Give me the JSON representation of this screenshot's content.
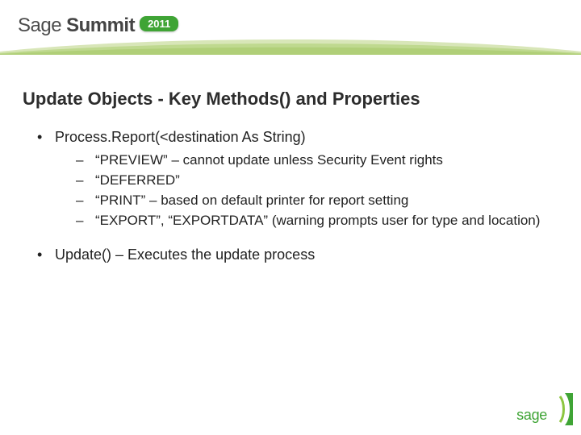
{
  "brand": {
    "word1": "Sage",
    "word2": "Summit",
    "year": "2011",
    "footer": "sage"
  },
  "title": "Update Objects - Key Methods() and Properties",
  "bullets": [
    {
      "text": "Process.Report(<destination As String)",
      "sub": [
        "“PREVIEW” – cannot update unless Security Event rights",
        "“DEFERRED”",
        "“PRINT” – based on default printer for report setting",
        "“EXPORT”, “EXPORTDATA” (warning prompts user for type and location)"
      ]
    },
    {
      "text": "Update() – Executes the update process",
      "sub": []
    }
  ],
  "colors": {
    "accent": "#3fa435",
    "swoosh1": "#d8e6b8",
    "swoosh2": "#bfd98f"
  }
}
